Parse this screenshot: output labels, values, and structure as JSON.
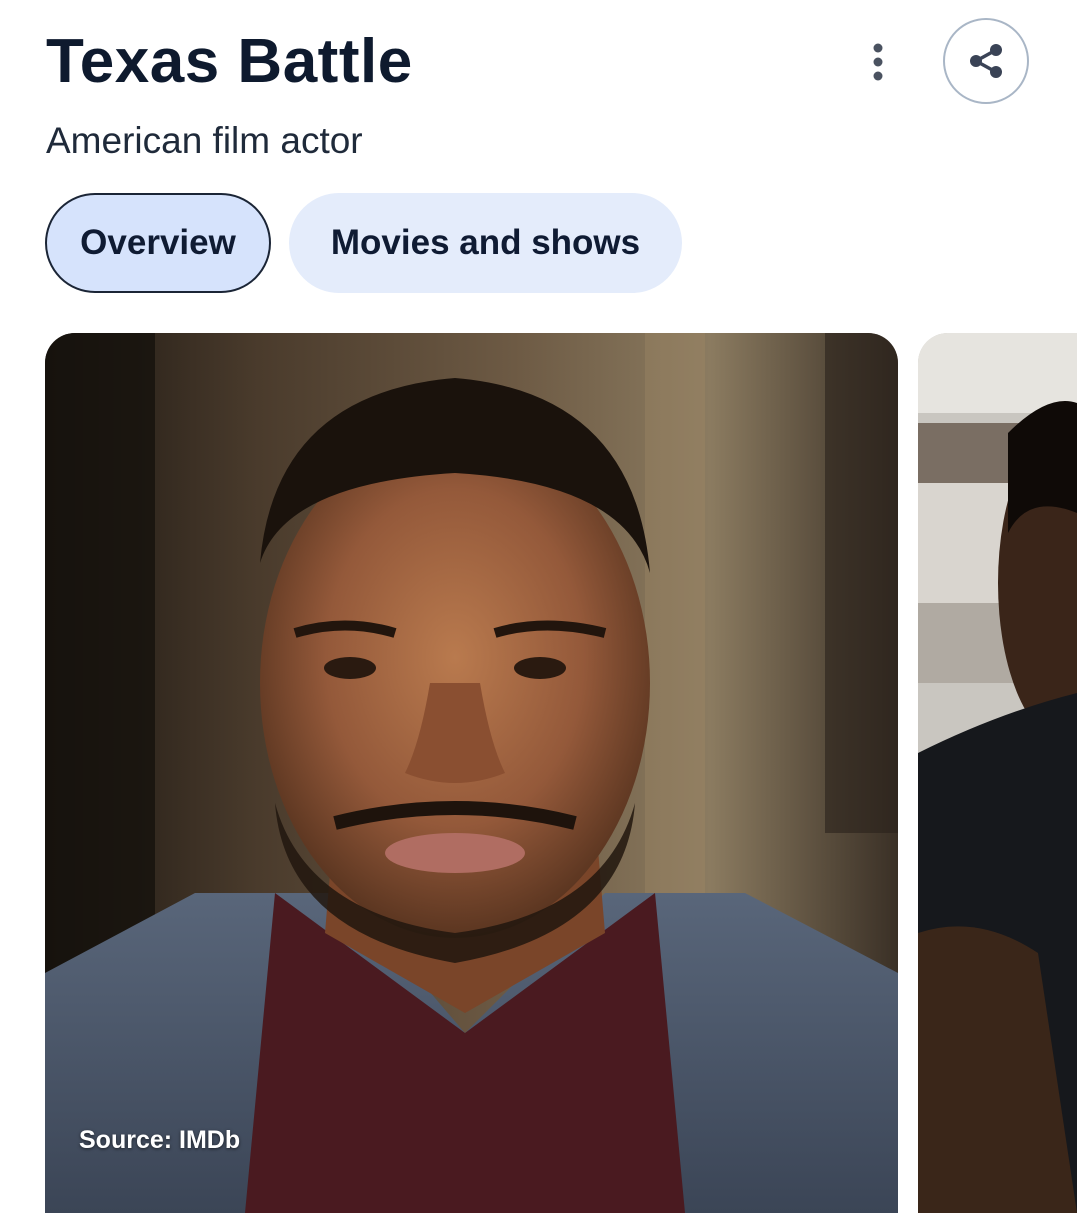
{
  "header": {
    "title": "Texas Battle",
    "subtitle": "American film actor",
    "more_icon": "more-vertical-icon",
    "share_icon": "share-icon"
  },
  "tabs": [
    {
      "label": "Overview",
      "active": true
    },
    {
      "label": "Movies and shows",
      "active": false
    }
  ],
  "images": [
    {
      "source": "Source: IMDb"
    },
    {
      "source": ""
    }
  ],
  "colors": {
    "title": "#0e1a2e",
    "tab_active_bg": "#d6e3fc",
    "tab_inactive_bg": "#e4ecfb",
    "share_border": "#a9b6c6"
  }
}
